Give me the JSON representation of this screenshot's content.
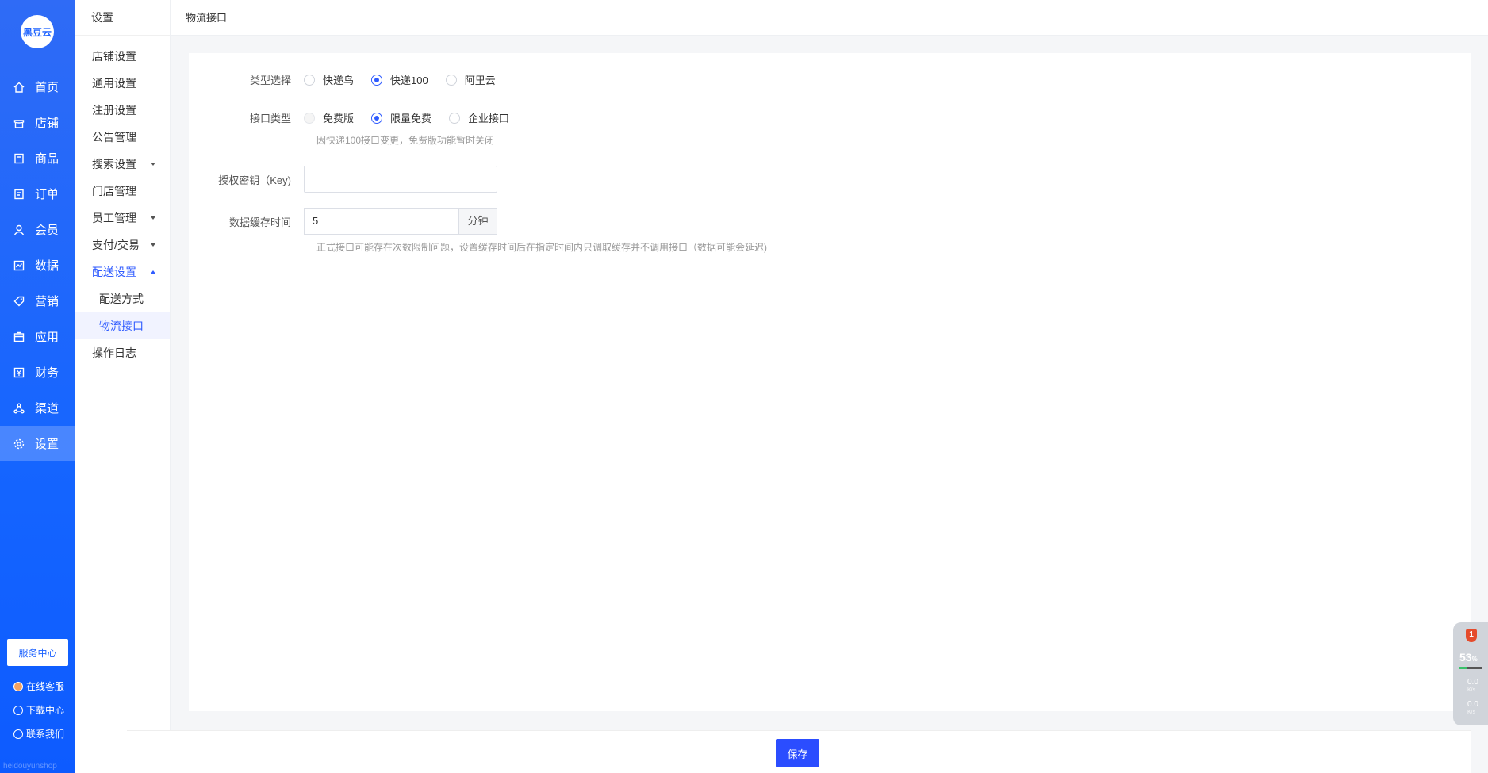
{
  "brand": {
    "logo_text": "黑豆云",
    "watermark": "heidouyunshop"
  },
  "main_nav": [
    {
      "label": "首页",
      "icon": "home-icon"
    },
    {
      "label": "店铺",
      "icon": "store-icon"
    },
    {
      "label": "商品",
      "icon": "goods-icon"
    },
    {
      "label": "订单",
      "icon": "order-icon"
    },
    {
      "label": "会员",
      "icon": "member-icon"
    },
    {
      "label": "数据",
      "icon": "chart-icon"
    },
    {
      "label": "营销",
      "icon": "tag-icon"
    },
    {
      "label": "应用",
      "icon": "app-icon"
    },
    {
      "label": "财务",
      "icon": "finance-icon"
    },
    {
      "label": "渠道",
      "icon": "channel-icon"
    },
    {
      "label": "设置",
      "icon": "gear-icon"
    }
  ],
  "service": {
    "center_label": "服务中心",
    "online": "在线客服",
    "download": "下载中心",
    "contact": "联系我们"
  },
  "sub_nav": {
    "title": "设置",
    "items": [
      "店铺设置",
      "通用设置",
      "注册设置",
      "公告管理",
      "搜索设置",
      "门店管理",
      "员工管理",
      "支付/交易",
      "配送设置"
    ],
    "children": [
      "配送方式",
      "物流接口"
    ],
    "last": "操作日志"
  },
  "breadcrumb": "物流接口",
  "form": {
    "type_label": "类型选择",
    "type_options": [
      "快递鸟",
      "快递100",
      "阿里云"
    ],
    "api_label": "接口类型",
    "api_options": [
      "免费版",
      "限量免费",
      "企业接口"
    ],
    "api_hint": "因快递100接口变更，免费版功能暂时关闭",
    "key_label": "授权密钥（Key)",
    "key_value": "",
    "cache_label": "数据缓存时间",
    "cache_value": "5",
    "cache_unit": "分钟",
    "cache_hint": "正式接口可能存在次数限制问题，设置缓存时间后在指定时间内只调取缓存并不调用接口（数据可能会延迟)"
  },
  "footer": {
    "save_label": "保存"
  },
  "widget": {
    "badge": "1",
    "percent": "53",
    "percent_unit": "%",
    "up": "0.0",
    "down": "0.0",
    "unit": "K/s"
  }
}
